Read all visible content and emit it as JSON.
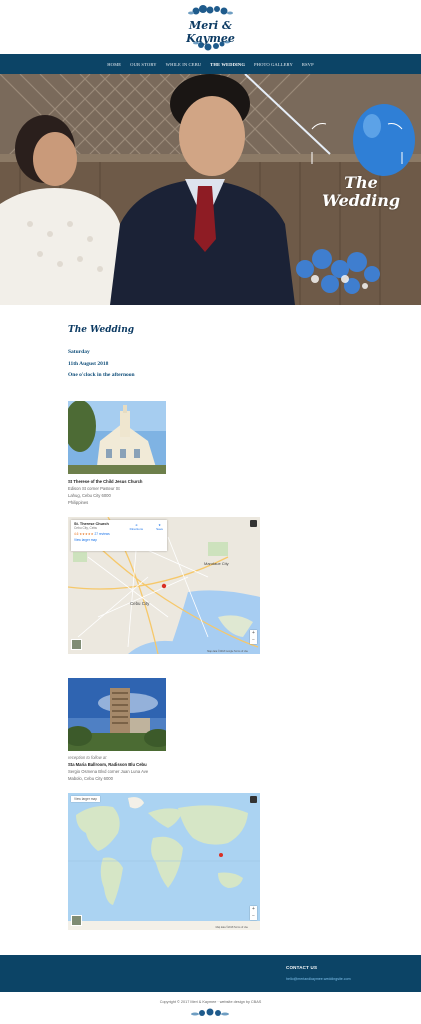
{
  "logo": {
    "text": "Meri & Kaymee",
    "icon": "floral-wreath-icon"
  },
  "nav": {
    "items": [
      {
        "label": "HOME"
      },
      {
        "label": "OUR STORY"
      },
      {
        "label": "WHILE IN CEBU"
      },
      {
        "label": "THE WEDDING",
        "active": true
      },
      {
        "label": "PHOTO GALLERY"
      },
      {
        "label": "RSVP"
      }
    ]
  },
  "hero": {
    "title_line1": "The",
    "title_line2": "Wedding"
  },
  "wedding": {
    "title": "The Wedding",
    "date_lines": [
      "Saturday",
      "11th August 2018",
      "One o'clock in the afternoon"
    ]
  },
  "ceremony": {
    "name": "St Therese of the Child Jesus Church",
    "address": [
      "Edison St corner Pasteur St",
      "Lahug, Cebu City 6000",
      "Philippines"
    ],
    "map": {
      "place": "St. Therese Church",
      "place_sub": "Cebu City, Cebu",
      "rating": "4.6 ★★★★★",
      "reviews": "27 reviews",
      "larger_map": "View larger map",
      "directions": "Directions",
      "save": "Save",
      "labels": [
        "Mandaue City",
        "Cebu City"
      ],
      "footer": "Map data ©2018 Google   Terms of Use"
    }
  },
  "reception": {
    "note": "reception to follow at",
    "name": "Sta Maria Ballroom, Radisson Blu Cebu",
    "address": [
      "Sergio Osmena Blvd corner Juan Luna Ave",
      "Mabolo, Cebu City 6000"
    ],
    "map": {
      "larger_map": "View larger map",
      "footer": "Map data ©2018   Terms of Use"
    }
  },
  "footer": {
    "contact_title": "CONTACT US",
    "contact_link": "hello@meriandkaymee.weddingsite.com",
    "copyright": "Copyright © 2017 Meri & Kaymee  ·  website design by CBAS"
  },
  "colors": {
    "brand": "#0c4466",
    "accent": "#0d4c78"
  }
}
